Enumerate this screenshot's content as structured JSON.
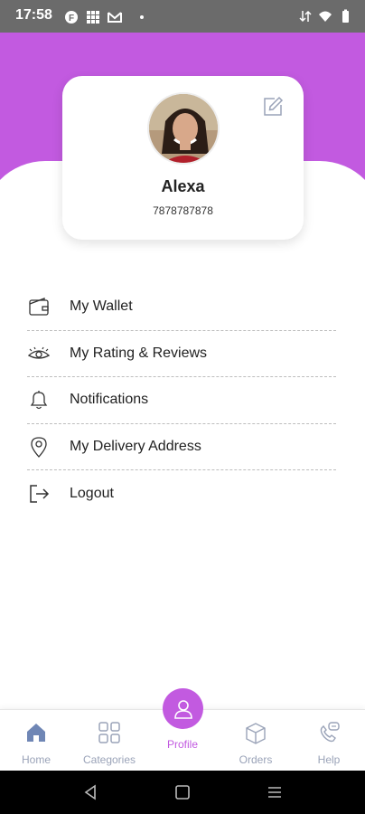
{
  "status_bar": {
    "time": "17:58",
    "icons": [
      "app-notification-icon",
      "grid-notification-icon",
      "mail-notification-icon",
      "wifi-icon",
      "battery-icon"
    ]
  },
  "profile": {
    "name": "Alexa",
    "phone": "7878787878"
  },
  "menu": {
    "items": [
      {
        "label": "My Wallet",
        "icon": "wallet-icon"
      },
      {
        "label": "My Rating & Reviews",
        "icon": "eye-icon"
      },
      {
        "label": "Notifications",
        "icon": "bell-icon"
      },
      {
        "label": "My Delivery Address",
        "icon": "location-pin-icon"
      },
      {
        "label": "Logout",
        "icon": "logout-icon"
      }
    ]
  },
  "bottom_nav": {
    "items": [
      {
        "label": "Home",
        "icon": "home-icon"
      },
      {
        "label": "Categories",
        "icon": "categories-icon"
      },
      {
        "label": "Profile",
        "icon": "user-icon",
        "active": true
      },
      {
        "label": "Orders",
        "icon": "box-icon"
      },
      {
        "label": "Help",
        "icon": "phone-help-icon"
      }
    ]
  },
  "colors": {
    "accent": "#c25ae0",
    "nav_inactive": "#9aa3b8",
    "status_bar": "#6b6b6b"
  }
}
